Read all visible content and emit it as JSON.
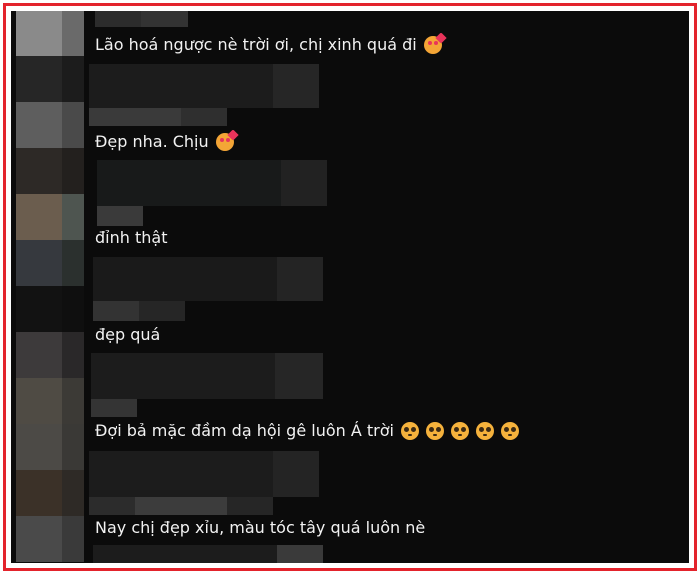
{
  "comments": [
    {
      "text": "Lão hoá ngược nè trời ơi, chị xinh quá đi",
      "emojis": [
        "smiling-face-with-hearts"
      ]
    },
    {
      "text": "Đẹp nha. Chịu",
      "emojis": [
        "smiling-face-with-hearts"
      ]
    },
    {
      "text": "đỉnh thật",
      "emojis": []
    },
    {
      "text": "đẹp quá",
      "emojis": []
    },
    {
      "text": "Đợi bả mặc đầm dạ hội gê luôn Á trời",
      "emojis": [
        "pleading-face",
        "pleading-face",
        "pleading-face",
        "pleading-face",
        "pleading-face"
      ]
    },
    {
      "text": "Nay chị đẹp xỉu, màu tóc tây quá luôn nè",
      "emojis": []
    }
  ],
  "colors": {
    "frame_border": "#e3232c",
    "background": "#0b0b0b",
    "text": "#f2f2f2"
  }
}
